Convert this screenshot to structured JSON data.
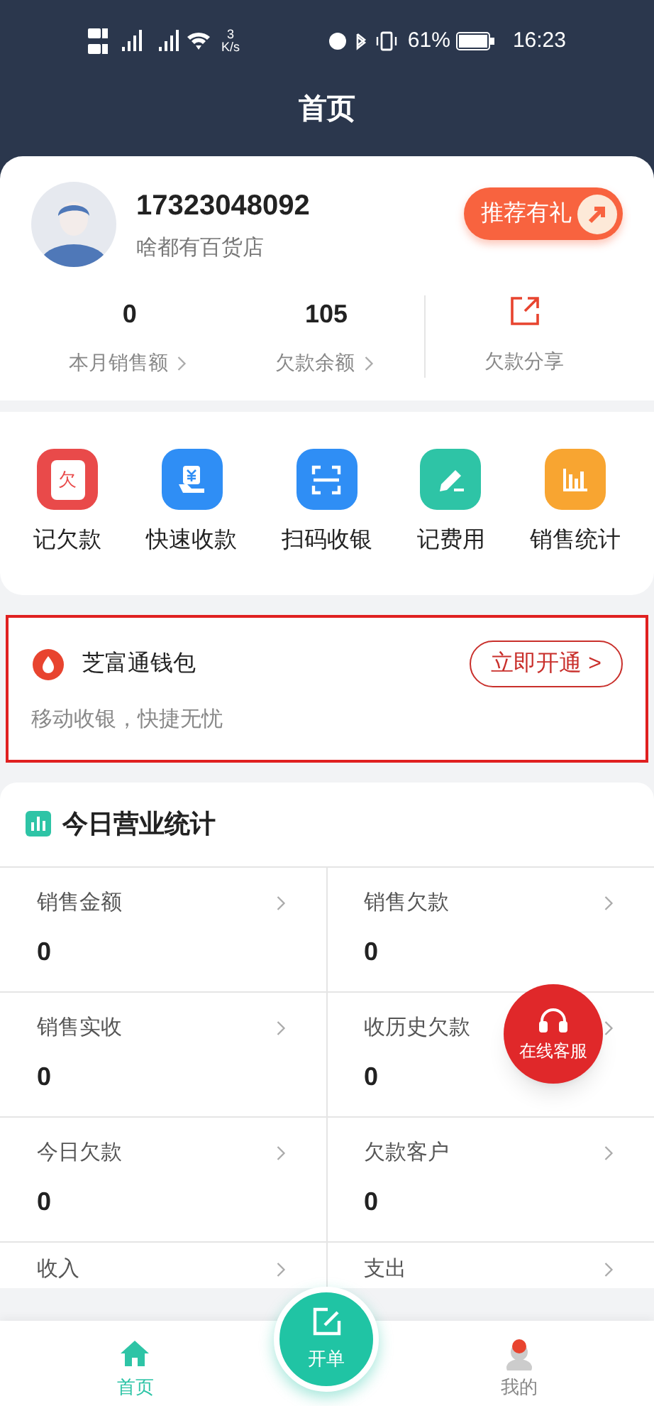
{
  "status_bar": {
    "speed_value": "3",
    "speed_unit": "K/s",
    "battery": "61%",
    "time": "16:23"
  },
  "header": {
    "title": "首页"
  },
  "profile": {
    "phone": "17323048092",
    "shop": "啥都有百货店",
    "referral_button": "推荐有礼"
  },
  "summary": [
    {
      "value": "0",
      "label": "本月销售额"
    },
    {
      "value": "105",
      "label": "欠款余额"
    }
  ],
  "share": {
    "label": "欠款分享"
  },
  "quick_actions": [
    {
      "kind": "debt",
      "label": "记欠款",
      "icon_text": "欠"
    },
    {
      "kind": "receive",
      "label": "快速收款"
    },
    {
      "kind": "scan",
      "label": "扫码收银"
    },
    {
      "kind": "expense",
      "label": "记费用"
    },
    {
      "kind": "stats",
      "label": "销售统计"
    }
  ],
  "wallet": {
    "title": "芝富通钱包",
    "subtitle": "移动收银，快捷无忧",
    "button": "立即开通 >"
  },
  "today_stats": {
    "title": "今日营业统计",
    "items": [
      {
        "label": "销售金额",
        "value": "0"
      },
      {
        "label": "销售欠款",
        "value": "0"
      },
      {
        "label": "销售实收",
        "value": "0"
      },
      {
        "label": "收历史欠款",
        "value": "0"
      },
      {
        "label": "今日欠款",
        "value": "0"
      },
      {
        "label": "欠款客户",
        "value": "0"
      },
      {
        "label": "收入"
      },
      {
        "label": "支出"
      }
    ]
  },
  "support_button": {
    "label": "在线客服"
  },
  "bottom_nav": {
    "tabs": [
      {
        "label": "首页",
        "selected": true
      },
      {
        "label": "我的",
        "selected": false
      }
    ],
    "center_button": "开单"
  }
}
